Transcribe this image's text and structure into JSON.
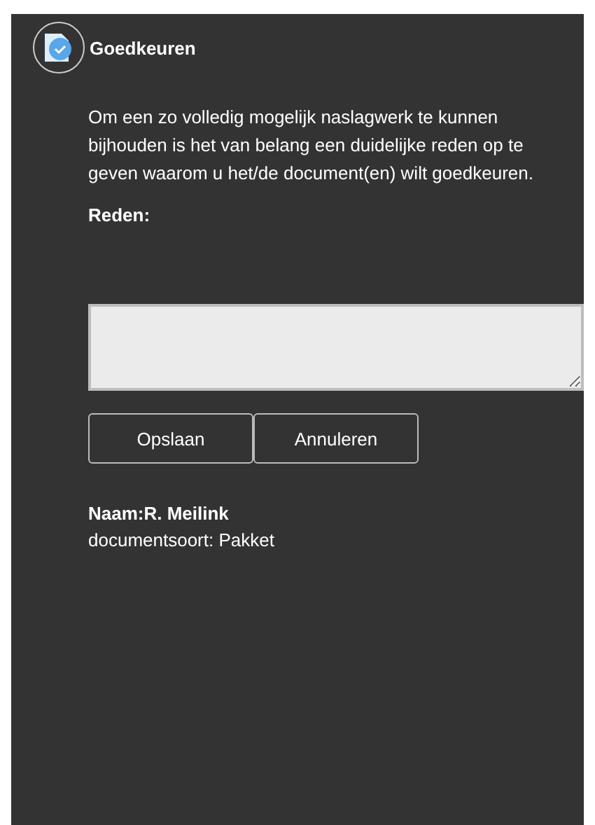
{
  "header": {
    "title": "Goedkeuren"
  },
  "intro": "Om een zo volledig mogelijk naslagwerk te kunnen bijhouden is het van belang een duidelijke reden op te geven waarom u het/de document(en) wilt goedkeuren.",
  "reason": {
    "label": "Reden:"
  },
  "buttons": [
    "Opslaan",
    "Annuleren"
  ],
  "details": {
    "name": "Naam:R. Meilink",
    "document_type": "documentsoort: Pakket"
  }
}
